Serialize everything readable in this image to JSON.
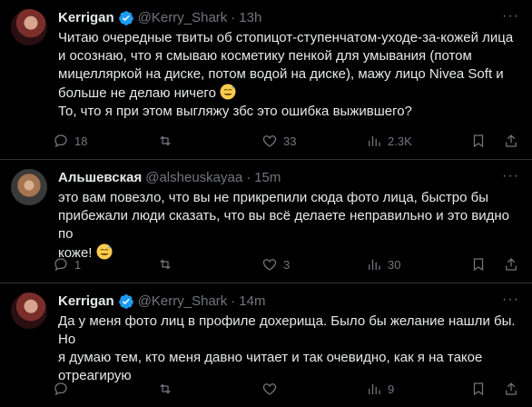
{
  "colors": {
    "background": "#000000",
    "text": "#e7e9ea",
    "muted": "#71767b",
    "verified": "#1d9bf0",
    "divider": "#2f3336"
  },
  "tweets": [
    {
      "name": "Kerrigan",
      "verified": true,
      "handle": "@Kerry_Shark",
      "dot": "·",
      "time": "13h",
      "text_lines": [
        "Читаю очередные твиты об стопицот-ступенчатом-уходе-за-кожей лица",
        "и осознаю, что я смываю косметику пенкой для умывания (потом",
        "мицелляркой на диске, потом водой на диске), мажу лицо Nivea Soft и",
        "больше не делаю ничего",
        "То, что я при этом выгляжу збс это ошибка выжившего?"
      ],
      "emoji_after_line": 3,
      "replies": "18",
      "reposts": "",
      "likes": "33",
      "views": "2.3K"
    },
    {
      "name": "Альшевская",
      "verified": false,
      "handle": "@alsheuskayaa",
      "dot": "·",
      "time": "15m",
      "text_lines": [
        "это вам повезло, что вы не прикрепили сюда фото лица, быстро бы",
        "прибежали люди сказать, что вы всё делаете неправильно и это видно по",
        "коже!"
      ],
      "emoji_after_line": 2,
      "replies": "1",
      "reposts": "",
      "likes": "3",
      "views": "30"
    },
    {
      "name": "Kerrigan",
      "verified": true,
      "handle": "@Kerry_Shark",
      "dot": "·",
      "time": "14m",
      "text_lines": [
        "Да у меня фото лиц в профиле дохерища. Было бы желание нашли бы. Но",
        "я думаю тем, кто меня давно читает и так очевидно, как я на такое",
        "отреагирую"
      ],
      "emoji_after_line": -1,
      "replies": "",
      "reposts": "",
      "likes": "",
      "views": "9"
    }
  ],
  "more_label": "···"
}
